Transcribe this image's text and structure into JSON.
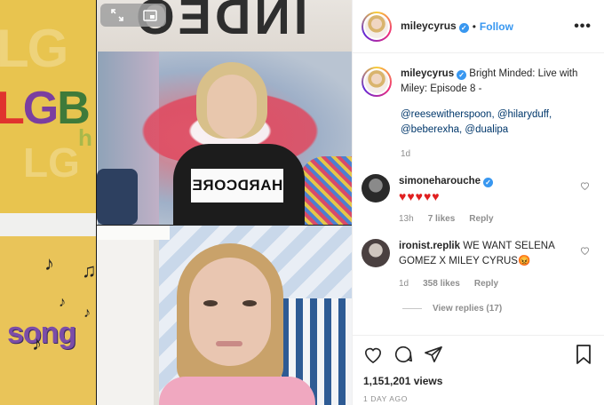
{
  "post": {
    "username": "mileycyrus",
    "follow_label": "Follow",
    "separator": "•",
    "more_label": "•••",
    "verified_mark": "✓"
  },
  "caption": {
    "username": "mileycyrus",
    "text": " Bright Minded: Live with Miley: Episode 8 -",
    "mentions": "@reesewitherspoon, @hilaryduff, @beberexha, @dualipa",
    "age": "1d"
  },
  "comments": [
    {
      "username": "simoneharouche",
      "verified": true,
      "text": "♥♥♥♥♥",
      "age": "13h",
      "likes": "7 likes",
      "reply_label": "Reply"
    },
    {
      "username": "ironist.replik",
      "verified": false,
      "text": "WE WANT SELENA GOMEZ X MILEY CYRUS😡",
      "age": "1d",
      "likes": "358 likes",
      "reply_label": "Reply"
    }
  ],
  "view_replies": "View replies (17)",
  "stats": {
    "views": "1,151,201 views",
    "date": "1 DAY AGO"
  },
  "video": {
    "banner_text": "INDEO",
    "shirt_text": "HARDCORE",
    "left_text_top": "LGB",
    "left_text_bottom": "song"
  },
  "colors": {
    "link": "#3897f0",
    "heart": "#e02020",
    "meta": "#8e8e8e"
  },
  "icons": [
    "expand-icon",
    "pip-icon",
    "heart-icon",
    "comment-icon",
    "share-icon",
    "bookmark-icon",
    "more-icon",
    "verified-icon"
  ]
}
